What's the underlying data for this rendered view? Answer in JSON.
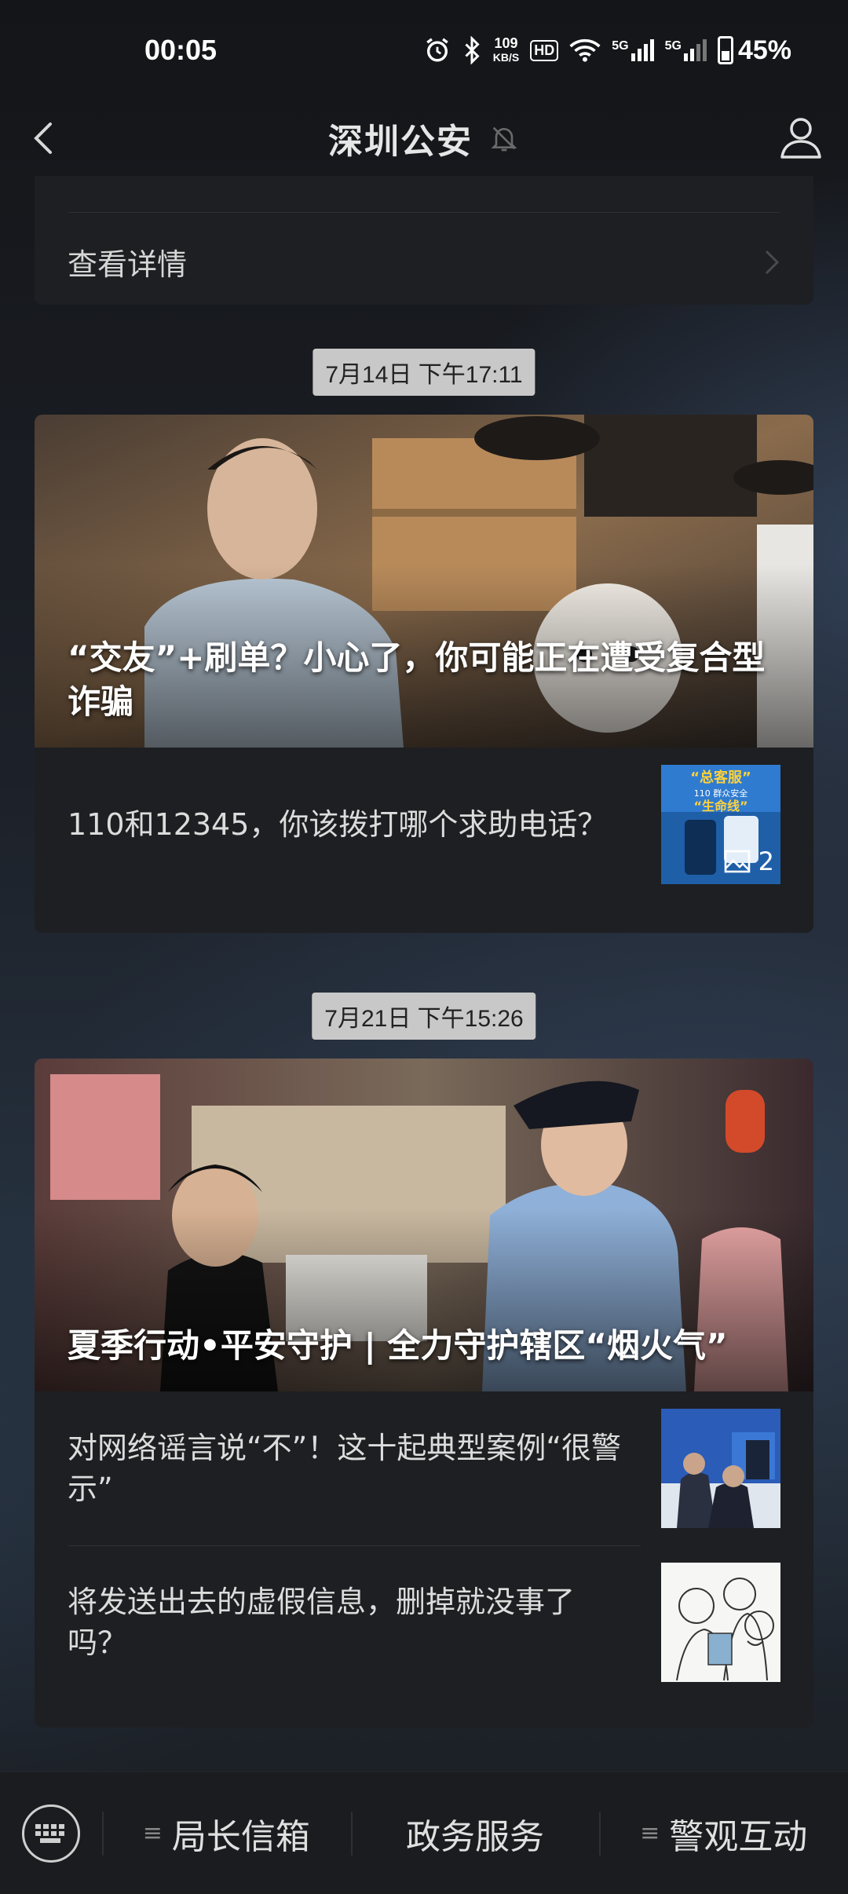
{
  "status_bar": {
    "time": "00:05",
    "net_speed_value": "109",
    "net_speed_unit": "KB/S",
    "hd": "HD",
    "signal1": "5G",
    "signal2": "5G",
    "battery": "45%"
  },
  "nav": {
    "title": "深圳公安"
  },
  "top_card": {
    "detail_label": "查看详情"
  },
  "groups": [
    {
      "time": "7月14日 下午17:11",
      "hero_title": "“交友”+刷单？小心了，你可能正在遭受复合型诈骗",
      "items": [
        {
          "text": "110和12345，你该拨打哪个求助电话？",
          "thumb_count": "2"
        }
      ]
    },
    {
      "time": "7月21日 下午15:26",
      "hero_title": "夏季行动•平安守护 | 全力守护辖区“烟火气”",
      "items": [
        {
          "text": "对网络谣言说“不”！这十起典型案例“很警示”"
        },
        {
          "text": "将发送出去的虚假信息，删掉就没事了吗？"
        }
      ]
    }
  ],
  "bottom_menu": {
    "items": [
      "局长信箱",
      "政务服务",
      "警观互动"
    ]
  },
  "colors": {
    "background": "#17181c",
    "card": "#1e1f22",
    "time_chip": "#c8c8c8"
  }
}
